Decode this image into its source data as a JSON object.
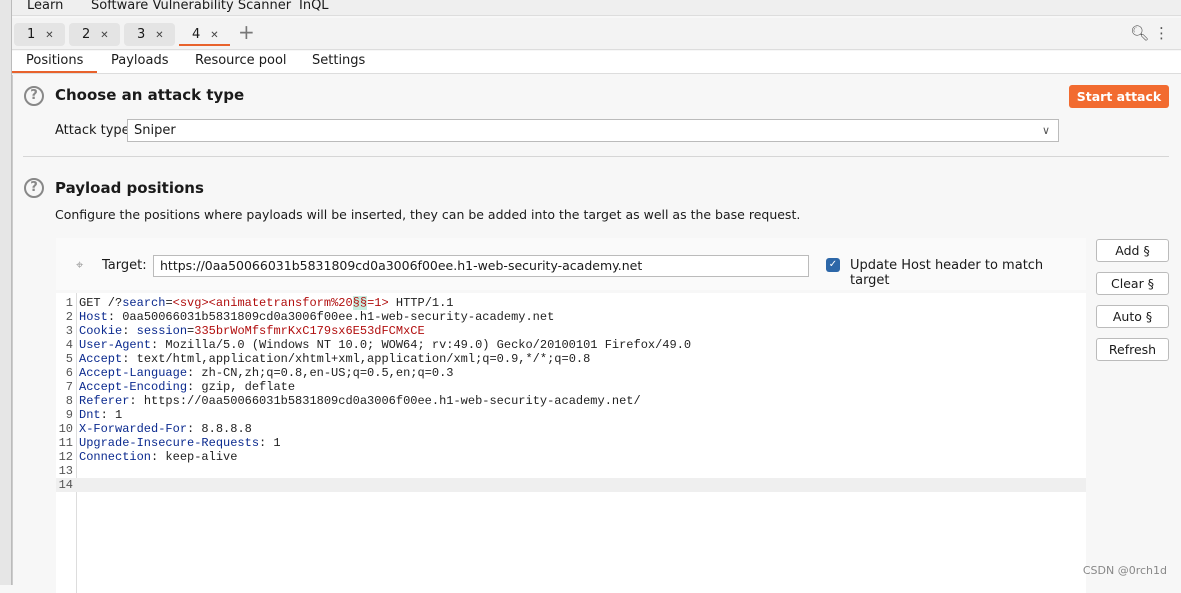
{
  "menubar": [
    "Learn",
    "Software Vulnerability Scanner",
    "InQL"
  ],
  "tabs": [
    {
      "label": "1"
    },
    {
      "label": "2"
    },
    {
      "label": "3"
    },
    {
      "label": "4",
      "active": true
    }
  ],
  "subtabs": [
    "Positions",
    "Payloads",
    "Resource pool",
    "Settings"
  ],
  "attack": {
    "title": "Choose an attack type",
    "start_label": "Start attack",
    "type_label": "Attack type:",
    "type_value": "Sniper"
  },
  "positions": {
    "title": "Payload positions",
    "description": "Configure the positions where payloads will be inserted, they can be added into the target as well as the base request.",
    "target_label": "Target:",
    "target_value": "https://0aa50066031b5831809cd0a3006f00ee.h1-web-security-academy.net",
    "update_host_label": "Update Host header to match target",
    "update_host_checked": true
  },
  "buttons": [
    "Add §",
    "Clear §",
    "Auto §",
    "Refresh"
  ],
  "request_lines": [
    [
      [
        "t",
        "GET /?"
      ],
      [
        "k",
        "search"
      ],
      [
        "t",
        "="
      ],
      [
        "v",
        "<svg><animatetransform%20"
      ],
      [
        "m",
        "§§"
      ],
      [
        "v",
        "=1>"
      ],
      [
        "t",
        " HTTP/1.1"
      ]
    ],
    [
      [
        "k",
        "Host"
      ],
      [
        "t",
        ": 0aa50066031b5831809cd0a3006f00ee.h1-web-security-academy.net"
      ]
    ],
    [
      [
        "k",
        "Cookie"
      ],
      [
        "t",
        ": "
      ],
      [
        "k",
        "session"
      ],
      [
        "t",
        "="
      ],
      [
        "v",
        "335brWoMfsfmrKxC179sx6E53dFCMxCE"
      ]
    ],
    [
      [
        "k",
        "User-Agent"
      ],
      [
        "t",
        ": Mozilla/5.0 (Windows NT 10.0; WOW64; rv:49.0) Gecko/20100101 Firefox/49.0"
      ]
    ],
    [
      [
        "k",
        "Accept"
      ],
      [
        "t",
        ": text/html,application/xhtml+xml,application/xml;q=0.9,*/*;q=0.8"
      ]
    ],
    [
      [
        "k",
        "Accept-Language"
      ],
      [
        "t",
        ": zh-CN,zh;q=0.8,en-US;q=0.5,en;q=0.3"
      ]
    ],
    [
      [
        "k",
        "Accept-Encoding"
      ],
      [
        "t",
        ": gzip, deflate"
      ]
    ],
    [
      [
        "k",
        "Referer"
      ],
      [
        "t",
        ": https://0aa50066031b5831809cd0a3006f00ee.h1-web-security-academy.net/"
      ]
    ],
    [
      [
        "k",
        "Dnt"
      ],
      [
        "t",
        ": 1"
      ]
    ],
    [
      [
        "k",
        "X-Forwarded-For"
      ],
      [
        "t",
        ": 8.8.8.8"
      ]
    ],
    [
      [
        "k",
        "Upgrade-Insecure-Requests"
      ],
      [
        "t",
        ": 1"
      ]
    ],
    [
      [
        "k",
        "Connection"
      ],
      [
        "t",
        ": keep-alive"
      ]
    ],
    [],
    []
  ],
  "colors": {
    "accent": "#f26b30",
    "header_key": "#0b2a8f",
    "value": "#b10e0e",
    "payload_marker_bg": "#c8ecdf",
    "checkbox": "#2d67a8"
  },
  "watermark": "CSDN @0rch1d"
}
